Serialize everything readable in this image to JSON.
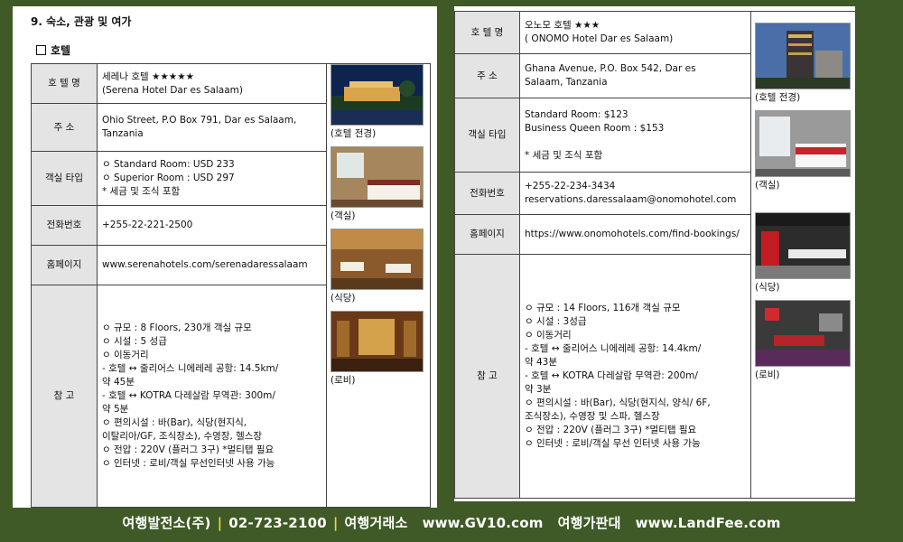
{
  "section_title": "9. 숙소, 관광 및 여가",
  "subsection_title": "호텔",
  "left_hotel": {
    "labels": {
      "name": "호 텔 명",
      "address": "주 소",
      "room_type": "객실 타입",
      "phone": "전화번호",
      "homepage": "홈페이지",
      "notes": "참 고"
    },
    "name_ko": "세레나 호텔",
    "stars": "★★★★★",
    "name_en": "(Serena Hotel Dar es Salaam)",
    "address_line1": "Ohio Street, P.O Box 791, Dar es Salaam,",
    "address_line2": "Tanzania",
    "rooms": [
      "ㅇ  Standard Room: USD 233",
      "ㅇ  Superior Room : USD 297",
      "*  세금 및 조식 포함"
    ],
    "phone": "+255-22-221-2500",
    "homepage": "www.serenahotels.com/serenadaressalaam",
    "notes": [
      "ㅇ  규모 : 8 Floors, 230개 객실 규모",
      "ㅇ  시설 : 5 성급",
      "ㅇ  이동거리",
      " -  호텔 ↔ 줄리어스 니에레레 공항: 14.5km/",
      "    약 45분",
      " -  호텔 ↔ KOTRA 다레살람 무역관: 300m/",
      "    약 5분",
      "ㅇ  편의시설 : 바(Bar), 식당(현지식,",
      "    이탈리아/GF, 조식장소), 수영장, 헬스장",
      "ㅇ  전압 : 220V (플러그 3구) *멀티탭 필요",
      "ㅇ  인터넷 : 로비/객실 무선인터넷 사용 가능"
    ],
    "captions": [
      "(호텔 전경)",
      "(객실)",
      "(식당)",
      "(로비)"
    ]
  },
  "right_hotel": {
    "labels": {
      "name": "호 텔 명",
      "address": "주 소",
      "room_type": "객실 타입",
      "phone": "전화번호",
      "homepage": "홈페이지",
      "notes": "참 고"
    },
    "name_ko": "오노모 호텔",
    "stars": "★★★",
    "name_en": "( ONOMO Hotel Dar es Salaam)",
    "address_line1": "Ghana Avenue, P.O. Box 542, Dar es",
    "address_line2": "Salaam, Tanzania",
    "rooms": [
      "Standard Room: $123",
      "Business Queen Room : $153",
      "",
      "* 세금 및 조식 포함"
    ],
    "phone_lines": [
      "+255-22-234-3434",
      "reservations.daressalaam@onomohotel.com"
    ],
    "homepage": "https://www.onomohotels.com/find-bookings/",
    "notes": [
      "ㅇ  규모 : 14 Floors, 116개 객실 규모",
      "ㅇ  시설 : 3성급",
      "ㅇ  이동거리",
      " -  호텔 ↔ 줄리어스 니에레레 공항: 14.4km/",
      "    약 43분",
      " -  호텔 ↔ KOTRA 다레살람 무역관: 200m/",
      "    약 3분",
      "ㅇ  편의시설 : 바(Bar), 식당(현지식, 양식/ 6F,",
      "    조식장소), 수영장 및 스파, 헬스장",
      "ㅇ  전압 : 220V (플러그 3구) *멀티탭 필요",
      "ㅇ  인터넷 : 로비/객실 무선 인터넷 사용 가능"
    ],
    "captions": [
      "(호텔 전경)",
      "(객실)",
      "(식당)",
      "(로비)"
    ]
  },
  "footer": {
    "company": "여행발전소(주)",
    "phone": "02-723-2100",
    "site1_label": "여행거래소",
    "site1_url": "www.GV10.com",
    "site2_label": "여행가판대",
    "site2_url": "www.LandFee.com",
    "separator": "|"
  }
}
